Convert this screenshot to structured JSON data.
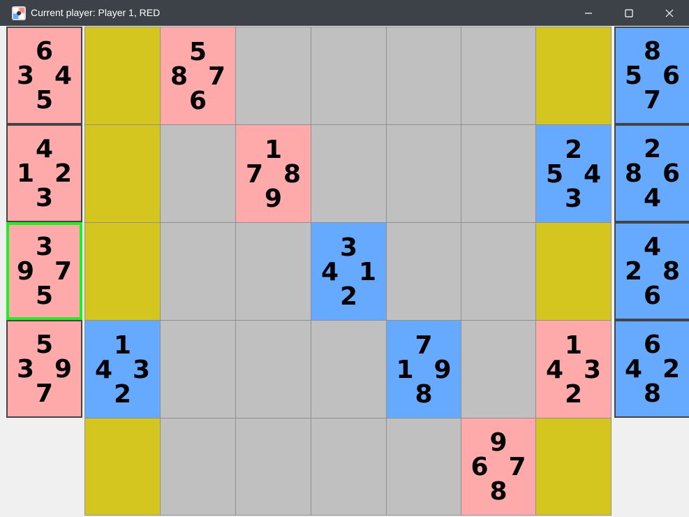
{
  "window": {
    "title": "Current player: Player 1, RED",
    "icon": "puzzle-app-icon",
    "buttons": [
      "minimize",
      "maximize",
      "close"
    ]
  },
  "colors": {
    "red_card": "#ffaaaa",
    "blue_card": "#66aaff",
    "empty_cell": "#c0c0c0",
    "corner_cell": "#d4c61f",
    "selection": "#22ee22"
  },
  "red_hand": [
    {
      "top": "6",
      "left": "3",
      "right": "4",
      "bottom": "5",
      "selected": false
    },
    {
      "top": "4",
      "left": "1",
      "right": "2",
      "bottom": "3",
      "selected": false
    },
    {
      "top": "3",
      "left": "9",
      "right": "7",
      "bottom": "5",
      "selected": true
    },
    {
      "top": "5",
      "left": "3",
      "right": "9",
      "bottom": "7",
      "selected": false
    }
  ],
  "blue_hand": [
    {
      "top": "8",
      "left": "5",
      "right": "6",
      "bottom": "7"
    },
    {
      "top": "2",
      "left": "8",
      "right": "6",
      "bottom": "4"
    },
    {
      "top": "4",
      "left": "2",
      "right": "8",
      "bottom": "6"
    },
    {
      "top": "6",
      "left": "4",
      "right": "2",
      "bottom": "8"
    }
  ],
  "board": [
    [
      {
        "kind": "corner"
      },
      {
        "kind": "red",
        "top": "5",
        "left": "8",
        "right": "7",
        "bottom": "6"
      },
      {
        "kind": "empty"
      },
      {
        "kind": "empty"
      },
      {
        "kind": "empty"
      },
      {
        "kind": "empty"
      },
      {
        "kind": "corner"
      }
    ],
    [
      {
        "kind": "corner"
      },
      {
        "kind": "empty"
      },
      {
        "kind": "red",
        "top": "1",
        "left": "7",
        "right": "8",
        "bottom": "9"
      },
      {
        "kind": "empty"
      },
      {
        "kind": "empty"
      },
      {
        "kind": "empty"
      },
      {
        "kind": "blue",
        "top": "2",
        "left": "5",
        "right": "4",
        "bottom": "3"
      }
    ],
    [
      {
        "kind": "corner"
      },
      {
        "kind": "empty"
      },
      {
        "kind": "empty"
      },
      {
        "kind": "blue",
        "top": "3",
        "left": "4",
        "right": "1",
        "bottom": "2"
      },
      {
        "kind": "empty"
      },
      {
        "kind": "empty"
      },
      {
        "kind": "corner"
      }
    ],
    [
      {
        "kind": "blue",
        "top": "1",
        "left": "4",
        "right": "3",
        "bottom": "2"
      },
      {
        "kind": "empty"
      },
      {
        "kind": "empty"
      },
      {
        "kind": "empty"
      },
      {
        "kind": "blue",
        "top": "7",
        "left": "1",
        "right": "9",
        "bottom": "8"
      },
      {
        "kind": "empty"
      },
      {
        "kind": "red",
        "top": "1",
        "left": "4",
        "right": "3",
        "bottom": "2"
      }
    ],
    [
      {
        "kind": "corner"
      },
      {
        "kind": "empty"
      },
      {
        "kind": "empty"
      },
      {
        "kind": "empty"
      },
      {
        "kind": "empty"
      },
      {
        "kind": "red",
        "top": "9",
        "left": "6",
        "right": "7",
        "bottom": "8"
      },
      {
        "kind": "corner"
      }
    ]
  ]
}
